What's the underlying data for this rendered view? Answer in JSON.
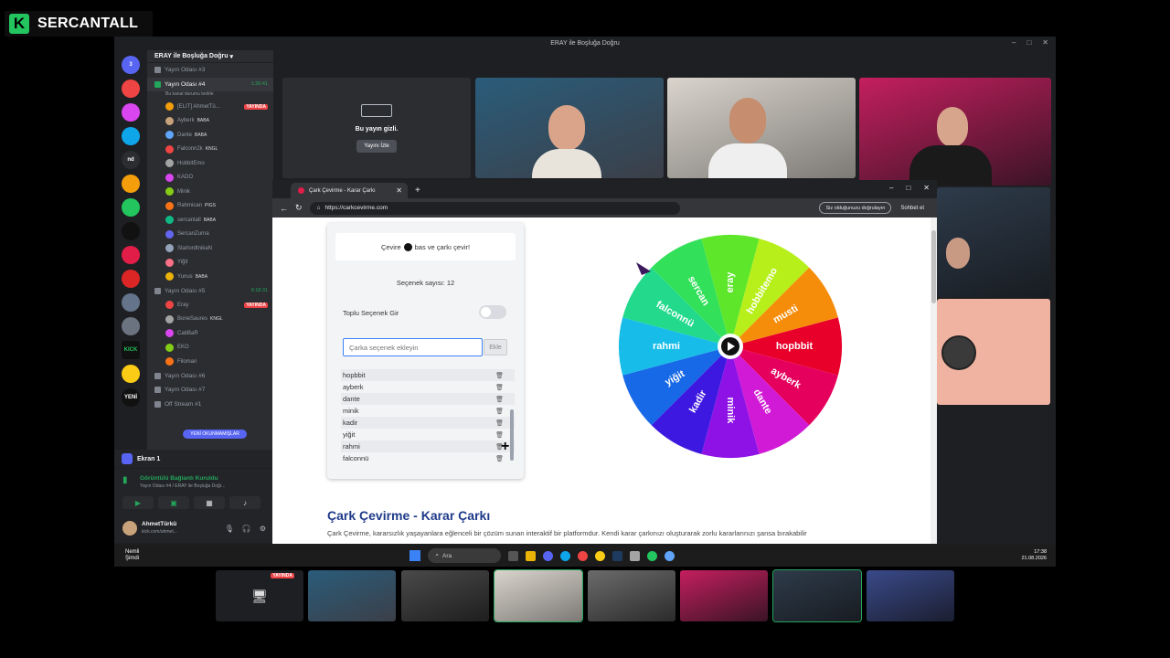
{
  "overlay": {
    "logo_letter": "K",
    "name": "SERCANTALL"
  },
  "discord": {
    "window_title": "ERAY ile Boşluğa Doğru",
    "server_name": "ERAY ile Boşluğa Doğru",
    "servers": [
      "3",
      "",
      "",
      "",
      "nd",
      "",
      "",
      "",
      "",
      "",
      "",
      "",
      "KICK",
      "",
      "YENİ"
    ],
    "channels_top": [
      "Yayın Odası #3"
    ],
    "active_channel": {
      "name": "Yayın Odası #4",
      "time": "1:20:41",
      "sub": "Bu kanal durumu belirle"
    },
    "users_room4": [
      {
        "name": "[ELIT] AhmetTü...",
        "tag": "",
        "live": "YAYINDA"
      },
      {
        "name": "Ayberk",
        "tag": "BABA"
      },
      {
        "name": "Dante",
        "tag": "BABA"
      },
      {
        "name": "Falconn2k",
        "tag": "KNGL"
      },
      {
        "name": "HobbitEmo",
        "tag": ""
      },
      {
        "name": "KADO",
        "tag": ""
      },
      {
        "name": "Minik",
        "tag": ""
      },
      {
        "name": "Rahmican",
        "tag": "PIGS"
      },
      {
        "name": "sercantall",
        "tag": "BABA"
      },
      {
        "name": "SercanZurna",
        "tag": ""
      },
      {
        "name": "StarlordtnikaN",
        "tag": ""
      },
      {
        "name": "Yiğit",
        "tag": ""
      },
      {
        "name": "Yunus",
        "tag": "BABA"
      }
    ],
    "room5": {
      "name": "Yayın Odası #5",
      "time": "9:18:31"
    },
    "users_room5": [
      {
        "name": "Eray",
        "tag": "",
        "live": "YAYINDA"
      },
      {
        "name": "BoneSaures",
        "tag": "KNGL"
      },
      {
        "name": "CabBaR",
        "tag": ""
      },
      {
        "name": "EKO",
        "tag": ""
      },
      {
        "name": "Filoman",
        "tag": ""
      }
    ],
    "channels_bottom": [
      "Yayın Odası #6",
      "Yayın Odası #7",
      "Off Stream #1"
    ],
    "new_notice": "YENİ OKUNMAMIŞLAR",
    "screen_label": "Ekran 1",
    "connection": {
      "status": "Görüntülü Bağlantı Kuruldu",
      "detail": "Yayın Odası #4 / ERAY ile Boşluğa Doğr..."
    },
    "user": {
      "name": "AhmetTürkü",
      "status": "kick.com/ahmet..."
    },
    "hidden_stream": {
      "label": "Bu yayın gizli.",
      "button": "Yayını İzle"
    }
  },
  "browser": {
    "tab_title": "Çark Çevirme - Karar Çarkı",
    "url": "https://carkcevirme.com",
    "verify_label": "Siz olduğunuzu doğrulayın",
    "chat_label": "Sohbet et"
  },
  "app": {
    "hint_pre": "Çevire",
    "hint_post": "bas ve çarkı çevir!",
    "count_label": "Seçenek sayısı: 12",
    "bulk_label": "Toplu Seçenek Gir",
    "bulk_enabled": false,
    "input_placeholder": "Çarka seçenek ekleyin",
    "add_button": "Ekle",
    "options": [
      "hopbbit",
      "ayberk",
      "dante",
      "minik",
      "kadir",
      "yiğit",
      "rahmi",
      "falconnü"
    ],
    "heading": "Çark Çevirme - Karar Çarkı",
    "description": "Çark Çevirme, kararsızlık yaşayanlara eğlenceli bir çözüm sunan interaktif bir platformdur. Kendi karar çarkınızı oluşturarak zorlu kararlarınızı şansa bırakabilir"
  },
  "wheel": {
    "segments": [
      {
        "label": "hopbbit",
        "color": "#e8002a"
      },
      {
        "label": "ayberk",
        "color": "#e6005e"
      },
      {
        "label": "dante",
        "color": "#d11ad6"
      },
      {
        "label": "minik",
        "color": "#8e12e6"
      },
      {
        "label": "kadir",
        "color": "#3d18e0"
      },
      {
        "label": "yiğit",
        "color": "#1769e8"
      },
      {
        "label": "rahmi",
        "color": "#17bde8"
      },
      {
        "label": "falconnü",
        "color": "#22d98c"
      },
      {
        "label": "sercan",
        "color": "#33e05a"
      },
      {
        "label": "eray",
        "color": "#5ee62b"
      },
      {
        "label": "hobbitemo",
        "color": "#b7ef1a"
      },
      {
        "label": "musti",
        "color": "#f58d0a"
      }
    ],
    "note": "wheel rotated so hopbbit points right"
  },
  "taskbar": {
    "notif_title": "Nemli",
    "notif_sub": "Şimdi",
    "search": "Ara",
    "time": "17:38",
    "date": "21.08.2026"
  },
  "strip": {
    "live_label": "YAYINDA"
  }
}
